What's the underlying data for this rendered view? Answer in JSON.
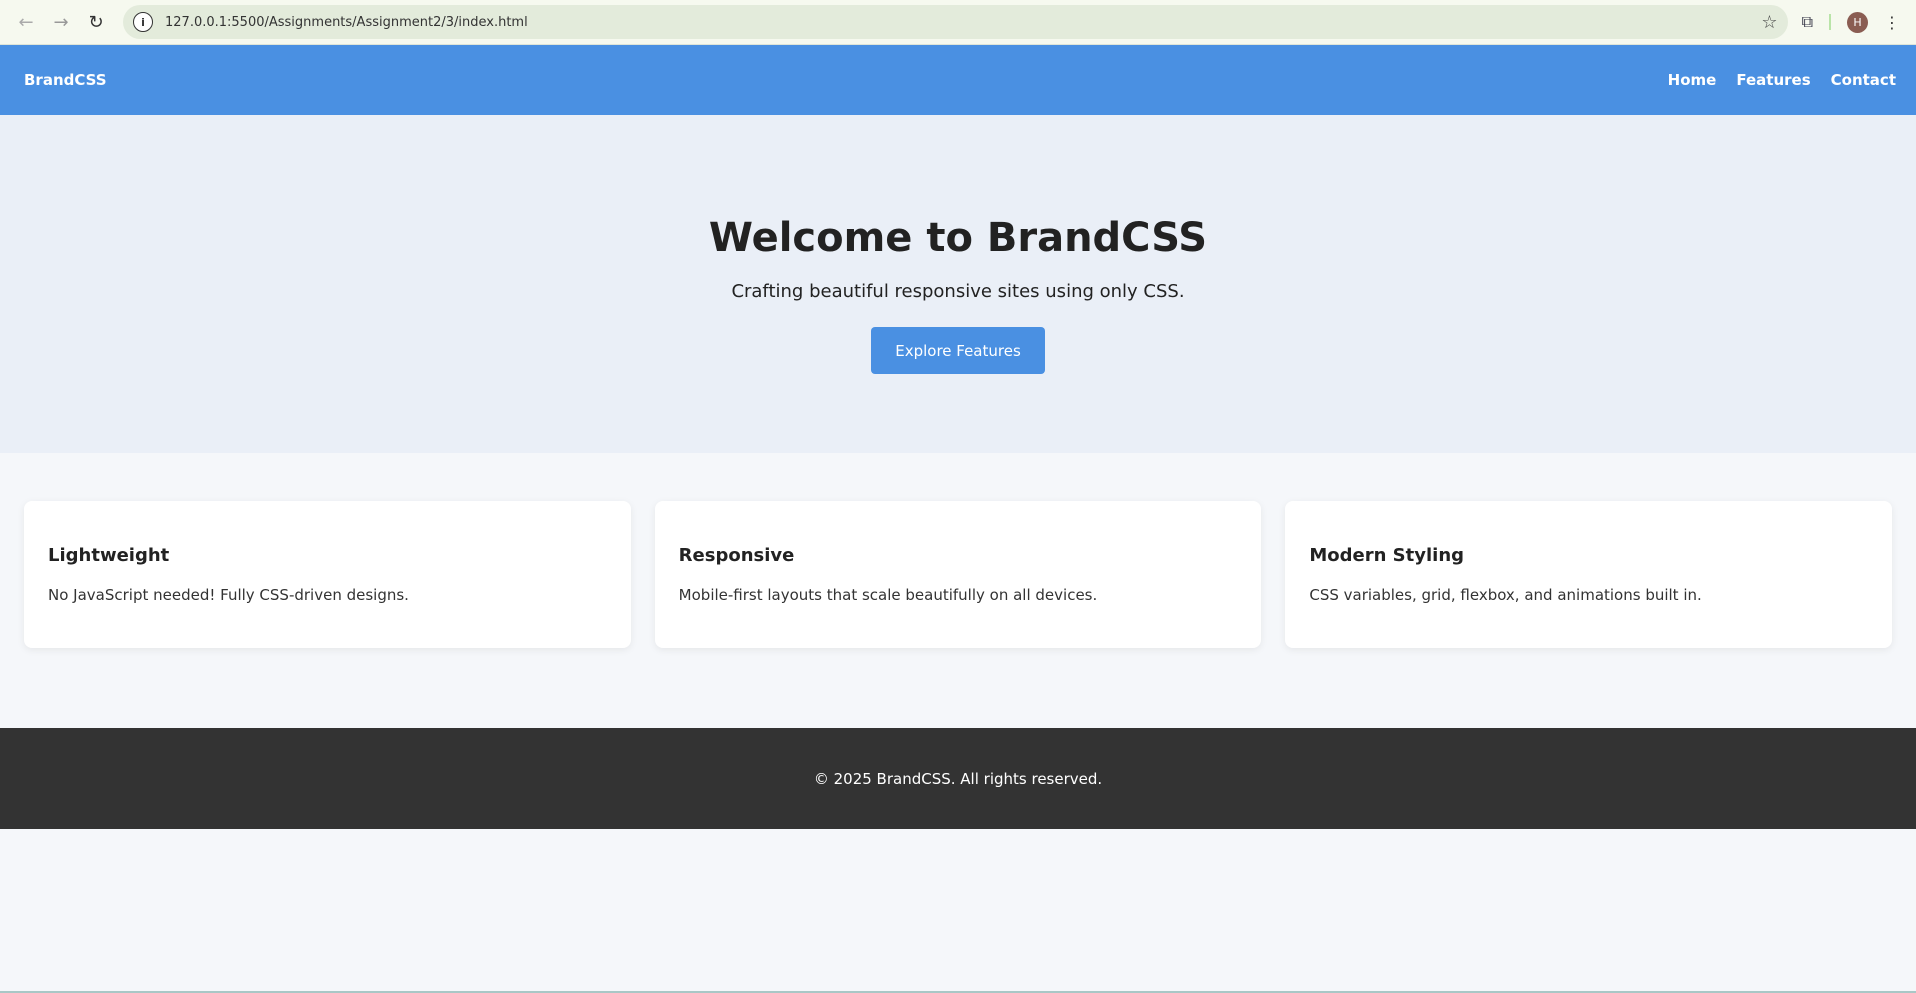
{
  "browser": {
    "url": "127.0.0.1:5500/Assignments/Assignment2/3/index.html",
    "profile_initial": "H"
  },
  "nav": {
    "brand": "BrandCSS",
    "links": [
      "Home",
      "Features",
      "Contact"
    ]
  },
  "hero": {
    "title": "Welcome to BrandCSS",
    "subtitle": "Crafting beautiful responsive sites using only CSS.",
    "button": "Explore Features"
  },
  "features": [
    {
      "title": "Lightweight",
      "text": "No JavaScript needed! Fully CSS-driven designs."
    },
    {
      "title": "Responsive",
      "text": "Mobile-first layouts that scale beautifully on all devices."
    },
    {
      "title": "Modern Styling",
      "text": "CSS variables, grid, flexbox, and animations built in."
    }
  ],
  "footer": {
    "text": "© 2025 BrandCSS. All rights reserved."
  }
}
